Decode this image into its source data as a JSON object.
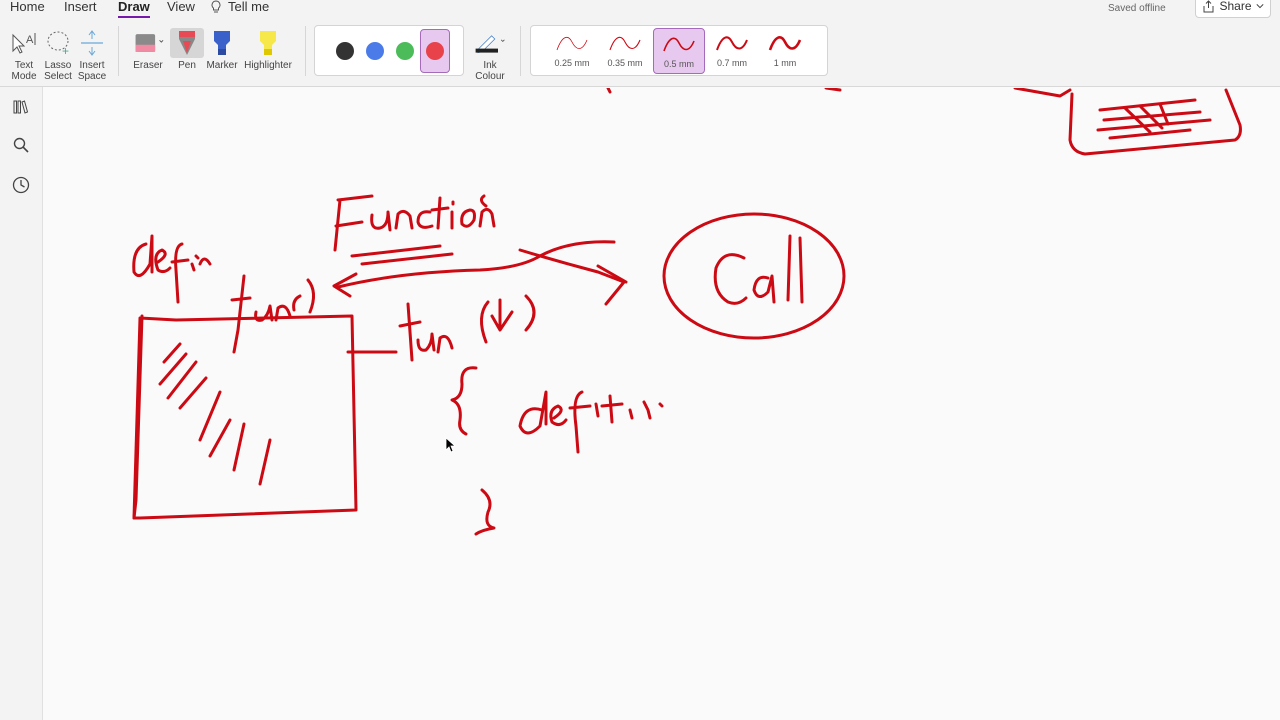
{
  "ribbon": {
    "tabs": [
      "Home",
      "Insert",
      "Draw",
      "View"
    ],
    "active_tab": "Draw",
    "tell_me": "Tell me",
    "status": "Saved offline",
    "share_label": "Share",
    "tools": {
      "text_mode": "Text Mode",
      "lasso_select": "Lasso Select",
      "insert_space": "Insert Space",
      "eraser": "Eraser",
      "pen": "Pen",
      "marker": "Marker",
      "highlighter": "Highlighter",
      "ink_colour": "Ink Colour"
    },
    "colors": [
      {
        "name": "black",
        "hex": "#333333"
      },
      {
        "name": "blue",
        "hex": "#4a7be8"
      },
      {
        "name": "green",
        "hex": "#4cbb5a"
      },
      {
        "name": "red",
        "hex": "#e8424a"
      }
    ],
    "selected_color": "red",
    "thicknesses": [
      "0.25 mm",
      "0.35 mm",
      "0.5 mm",
      "0.7 mm",
      "1 mm"
    ],
    "selected_thickness": "0.5 mm"
  },
  "nav": {
    "icons": [
      "notebooks-icon",
      "search-icon",
      "recent-icon"
    ]
  },
  "ink": {
    "color": "#cc0a14",
    "handwriting": [
      "Functions",
      "define",
      "fun()",
      "fun (args)",
      "definition",
      "Call"
    ]
  }
}
